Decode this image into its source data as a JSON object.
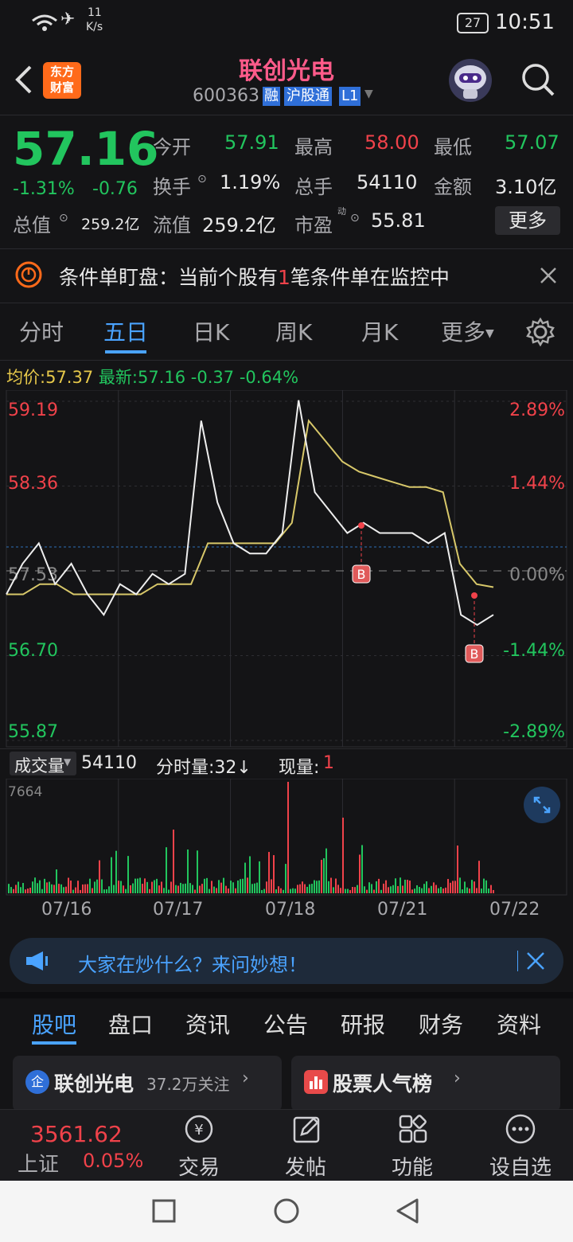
{
  "status": {
    "speed_value": "11",
    "speed_unit": "K/s",
    "battery": "27",
    "time": "10:51"
  },
  "header": {
    "logo_line1": "东方",
    "logo_line2": "财富",
    "title": "联创光电",
    "code": "600363",
    "tag_rong": "融",
    "tag_hgt": "沪股通",
    "tag_level": "L1"
  },
  "quote": {
    "price": "57.16",
    "change_pct": "-1.31%",
    "change_amt": "-0.76",
    "open_label": "今开",
    "open": "57.91",
    "high_label": "最高",
    "high": "58.00",
    "low_label": "最低",
    "low": "57.07",
    "turnover_label": "换手",
    "turnover": "1.19%",
    "volume_label": "总手",
    "volume": "54110",
    "amount_label": "金额",
    "amount": "3.10亿",
    "mcap_label": "总值",
    "mcap": "259.2亿",
    "float_label": "流值",
    "float": "259.2亿",
    "pe_label": "市盈",
    "pe_sup": "动",
    "pe": "55.81",
    "more": "更多"
  },
  "notice": {
    "prefix": "条件单盯盘：当前个股有",
    "count": "1",
    "suffix": "笔条件单在监控中"
  },
  "tabs": [
    "分时",
    "五日",
    "日K",
    "周K",
    "月K",
    "更多"
  ],
  "legend": {
    "avg_label": "均价:",
    "avg": "57.37",
    "last_label": "最新:",
    "last": "57.16",
    "chg": "-0.37",
    "chg_pct": "-0.64%"
  },
  "chart_data": {
    "type": "line",
    "price_axis": [
      "59.19",
      "58.36",
      "57.53",
      "56.70",
      "55.87"
    ],
    "pct_axis": [
      "2.89%",
      "1.44%",
      "0.00%",
      "-1.44%",
      "-2.89%"
    ],
    "ylim": [
      55.87,
      59.19
    ],
    "dates": [
      "07/16",
      "07/17",
      "07/18",
      "07/21",
      "07/22"
    ],
    "series": [
      {
        "values": [
          57.3,
          57.6,
          57.8,
          57.4,
          57.6,
          57.3,
          57.1,
          57.4,
          57.3,
          57.5,
          57.4,
          57.5,
          59.0,
          58.2,
          57.8,
          57.7,
          57.7,
          57.9,
          59.2,
          58.3,
          58.1,
          57.9,
          58.0,
          57.9,
          57.9,
          57.9,
          57.8,
          57.9,
          57.1,
          57.0,
          57.1
        ]
      },
      {
        "values": [
          57.3,
          57.3,
          57.4,
          57.4,
          57.3,
          57.3,
          57.3,
          57.3,
          57.3,
          57.4,
          57.4,
          57.4,
          57.8,
          57.8,
          57.8,
          57.8,
          57.8,
          58.0,
          59.0,
          58.8,
          58.6,
          58.5,
          58.45,
          58.4,
          58.35,
          58.35,
          58.3,
          57.6,
          57.4,
          57.37
        ]
      }
    ],
    "markers": [
      "B",
      "B"
    ],
    "volume": {
      "label": "成交量",
      "total": "54110",
      "tick_label": "分时量:32↓",
      "now_label": "现量:",
      "now": "1",
      "max": "7664"
    }
  },
  "banner": {
    "text": "大家在炒什么？来问妙想！"
  },
  "bottom_tabs": [
    "股吧",
    "盘口",
    "资讯",
    "公告",
    "研报",
    "财务",
    "资料"
  ],
  "cards": {
    "left_title": "联创光电",
    "left_sub": "37.2万关注",
    "right_title": "股票人气榜"
  },
  "toolbar": {
    "index_value": "3561.62",
    "index_name": "上证",
    "index_pct": "0.05%",
    "trade": "交易",
    "post": "发帖",
    "func": "功能",
    "watch": "设自选"
  }
}
